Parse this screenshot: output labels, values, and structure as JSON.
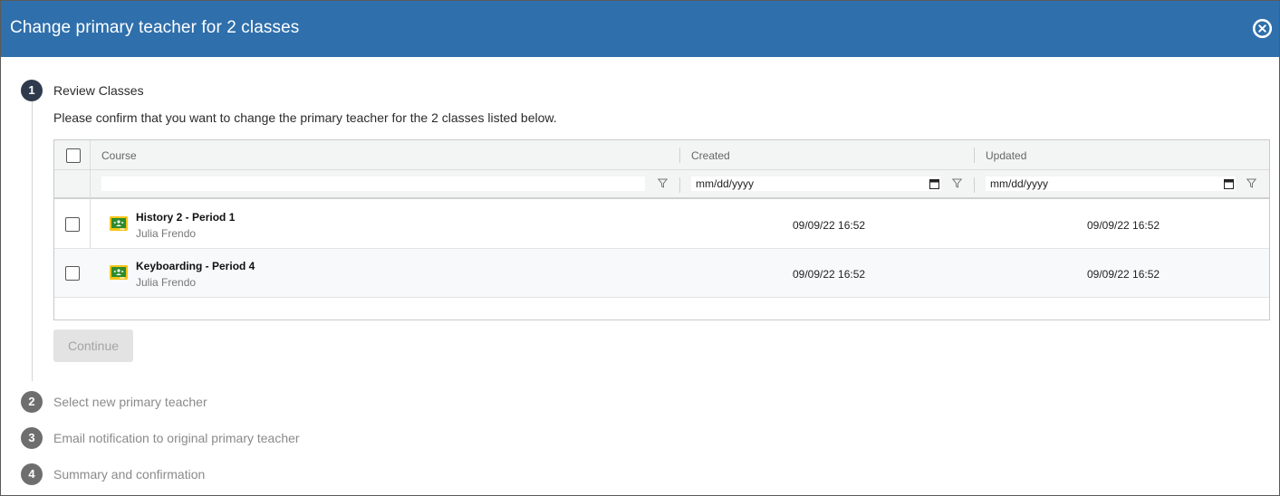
{
  "dialog": {
    "title": "Change primary teacher for 2 classes"
  },
  "steps": [
    {
      "number": "1",
      "label": "Review Classes"
    },
    {
      "number": "2",
      "label": "Select new primary teacher"
    },
    {
      "number": "3",
      "label": "Email notification to original primary teacher"
    },
    {
      "number": "4",
      "label": "Summary and confirmation"
    }
  ],
  "review": {
    "instructions": "Please confirm that you want to change the primary teacher for the 2 classes listed below.",
    "columns": {
      "course": "Course",
      "created": "Created",
      "updated": "Updated"
    },
    "filters": {
      "course_value": "",
      "created_placeholder": "mm/dd/yyyy",
      "updated_placeholder": "mm/dd/yyyy"
    },
    "rows": [
      {
        "course": "History 2 - Period 1",
        "teacher": "Julia Frendo",
        "created": "09/09/22 16:52",
        "updated": "09/09/22 16:52"
      },
      {
        "course": "Keyboarding - Period 4",
        "teacher": "Julia Frendo",
        "created": "09/09/22 16:52",
        "updated": "09/09/22 16:52"
      }
    ],
    "continue_label": "Continue"
  },
  "icons": {
    "close": "close-icon",
    "filter": "filter-icon",
    "calendar": "calendar-icon",
    "course": "google-classroom-icon"
  },
  "colors": {
    "header": "#2f6fab",
    "active_step": "#2f3b4d",
    "inactive_step": "#6e6e6e",
    "classroom_green": "#2e8b2e",
    "classroom_yellow": "#f5c518"
  }
}
